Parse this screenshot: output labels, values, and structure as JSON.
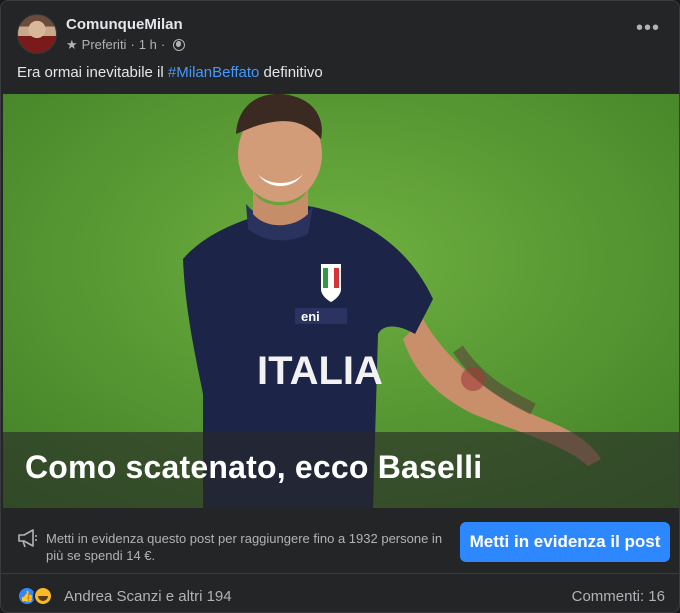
{
  "post": {
    "page_name": "ComunqueMilan",
    "audience_label": "Preferiti",
    "separator": "·",
    "time": "1 h",
    "message_prefix": "Era ormai inevitabile il ",
    "hashtag": "#MilanBeffato",
    "message_suffix": " definitivo",
    "more_icon": "more-horizontal-icon",
    "audience_icon": "globe-icon"
  },
  "media": {
    "headline": "Como scatenato, ecco Baselli",
    "jersey_text": "ITALIA",
    "sponsor_text": "eni"
  },
  "boost": {
    "text": "Metti in evidenza questo post per raggiungere fino a 1932 persone in più se spendi 14 €.",
    "button_label": "Metti in evidenza il post",
    "icon": "megaphone-icon"
  },
  "footer": {
    "reacted_by": "Andrea Scanzi e altri 194",
    "comments": "Commenti: 16",
    "reactions": [
      "like",
      "haha"
    ]
  },
  "colors": {
    "background": "#242526",
    "accent": "#2d88ff",
    "hashtag": "#4599ff",
    "secondary_text": "#b0b3b8"
  }
}
